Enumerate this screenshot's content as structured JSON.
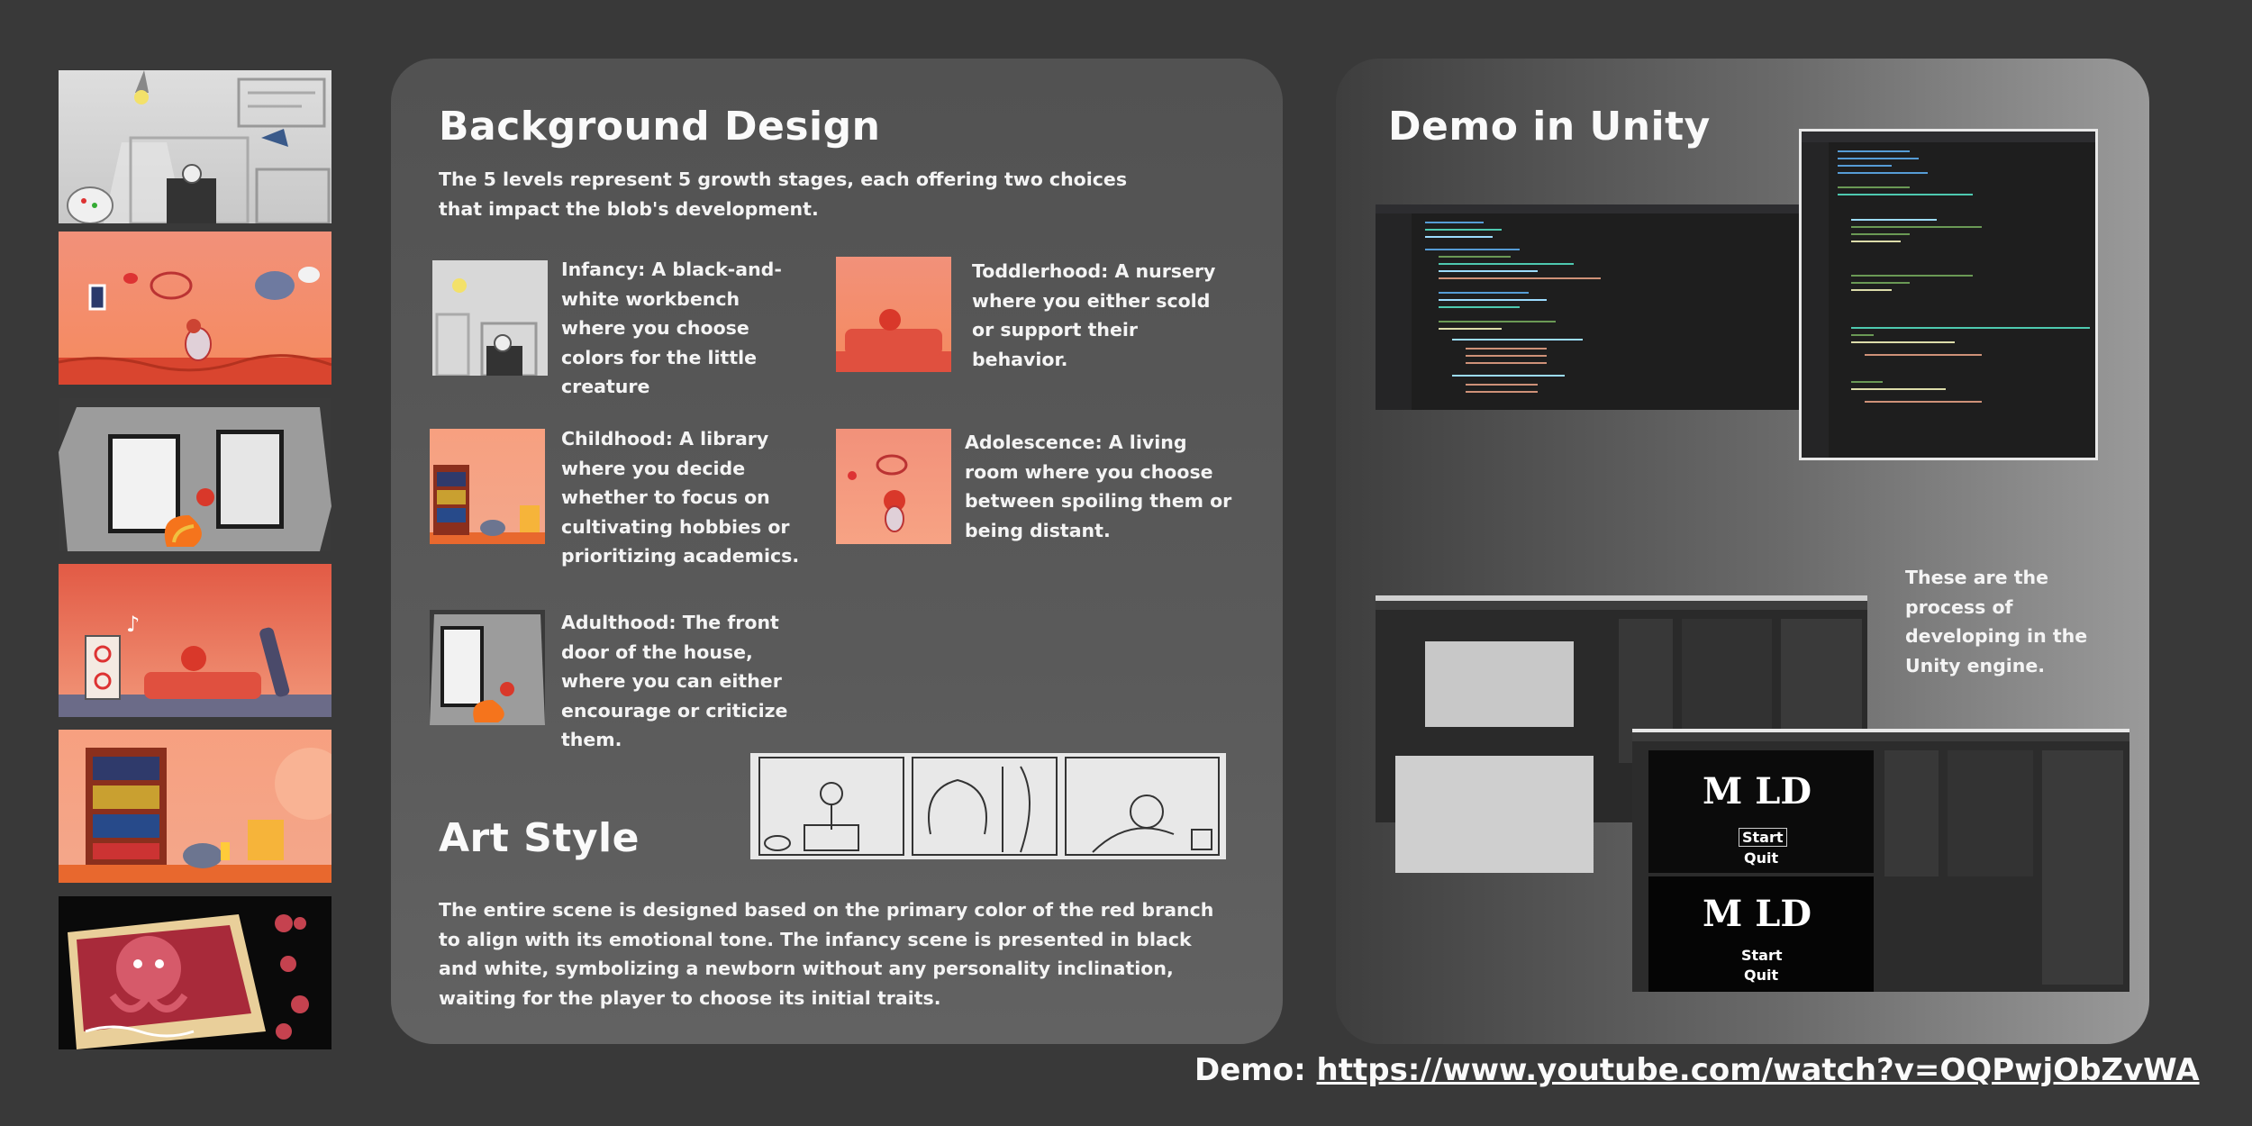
{
  "background_design": {
    "title": "Background Design",
    "intro": "The 5 levels represent 5 growth stages, each offering two choices that impact the blob's development.",
    "stages": [
      {
        "name": "infancy",
        "text": "Infancy: A black-and-white workbench where you choose colors for the little creature"
      },
      {
        "name": "toddlerhood",
        "text": "Toddlerhood: A nursery where you either scold or support their behavior."
      },
      {
        "name": "childhood",
        "text": "Childhood: A library where you decide whether to focus on cultivating hobbies or prioritizing academics."
      },
      {
        "name": "adolescence",
        "text": "Adolescence: A living room where you choose between spoiling them or being distant."
      },
      {
        "name": "adulthood",
        "text": "Adulthood: The front door of the house, where you can either encourage or criticize them."
      }
    ]
  },
  "art_style": {
    "title": "Art Style",
    "text": "The entire scene is designed based on the primary color of the red branch to align with its emotional tone. The infancy scene is presented in black and white, symbolizing a newborn without any personality inclination, waiting for the player to choose its initial traits."
  },
  "demo_unity": {
    "title": "Demo in Unity",
    "note": "These are the process of developing in the Unity engine.",
    "game_title_1": "M LD",
    "game_title_2": "M LD",
    "start_label": "Start",
    "quit_label": "Quit"
  },
  "footer": {
    "label": "Demo: ",
    "url": "https://www.youtube.com/watch?v=OQPwjObZvWA"
  },
  "colors": {
    "page_bg": "#393939",
    "accent_red": "#e8604a",
    "peach": "#f6a07a"
  }
}
